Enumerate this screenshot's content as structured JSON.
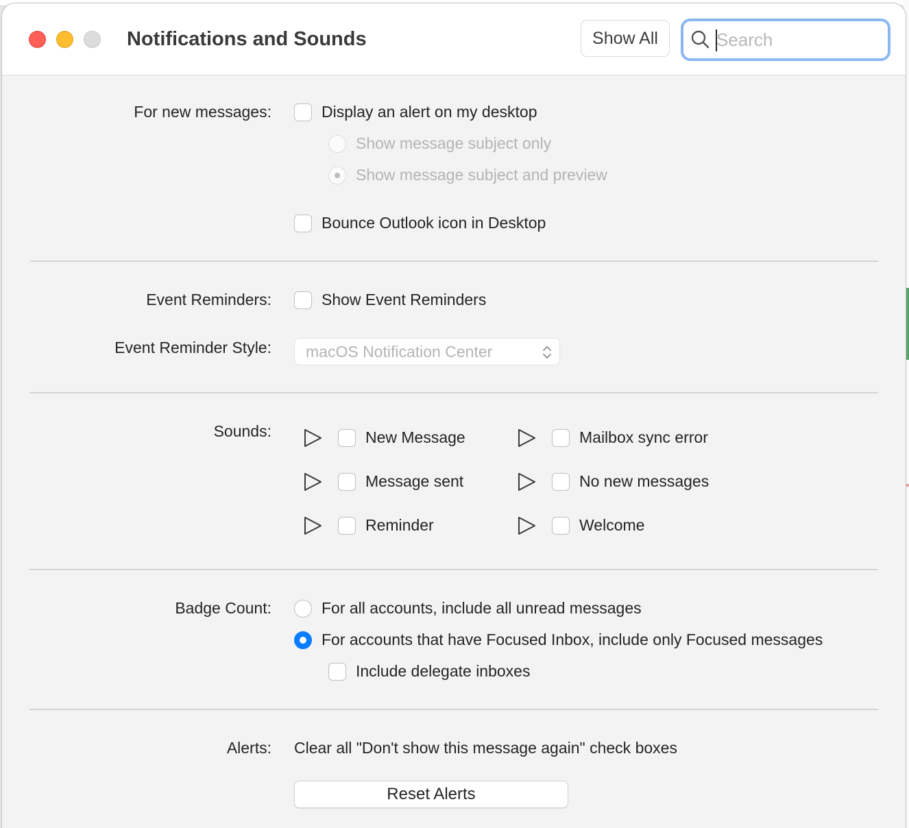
{
  "window": {
    "title": "Notifications and Sounds",
    "show_all_label": "Show All",
    "search_placeholder": "Search"
  },
  "new_messages": {
    "label": "For new messages:",
    "display_alert": "Display an alert on my desktop",
    "subject_only": "Show message subject only",
    "subject_and_preview": "Show message subject and preview",
    "bounce_icon": "Bounce Outlook icon in Desktop"
  },
  "events": {
    "reminders_label": "Event Reminders:",
    "show_reminders": "Show Event Reminders",
    "style_label": "Event Reminder Style:",
    "style_value": "macOS Notification Center"
  },
  "sounds": {
    "label": "Sounds:",
    "items": [
      "New Message",
      "Mailbox sync error",
      "Message sent",
      "No new messages",
      "Reminder",
      "Welcome"
    ]
  },
  "badge": {
    "label": "Badge Count:",
    "all_accounts": "For all accounts, include all unread messages",
    "focused_only": "For accounts that have Focused Inbox, include only Focused messages",
    "delegate": "Include delegate inboxes"
  },
  "alerts": {
    "label": "Alerts:",
    "description": "Clear all \"Don't show this message again\" check boxes",
    "reset_button": "Reset Alerts"
  },
  "colors": {
    "accent": "#0a7cff",
    "close": "#fe5f57",
    "minimize": "#febc2e",
    "search_focus": "#8ab7f0"
  }
}
